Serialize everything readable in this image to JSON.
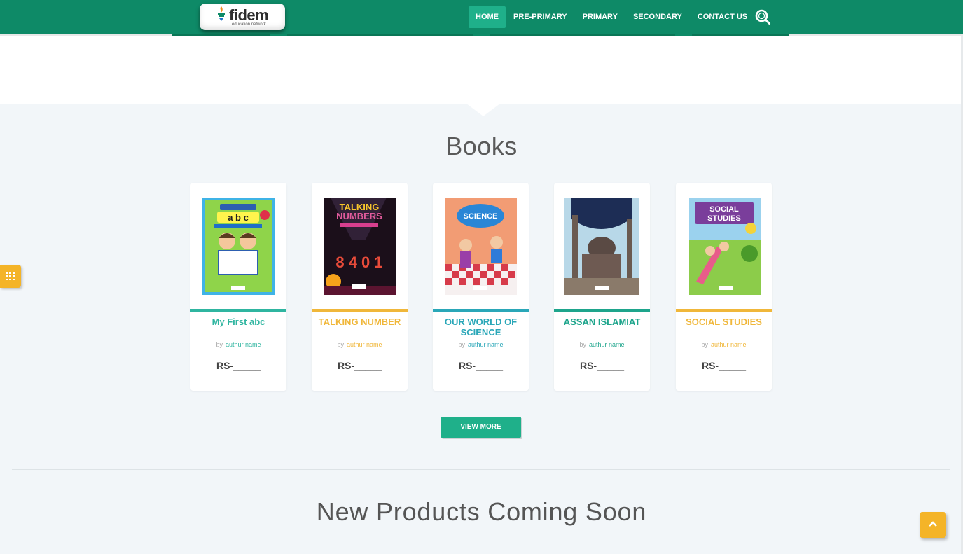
{
  "brand": {
    "name": "fidem",
    "tagline": "education network"
  },
  "nav": {
    "items": [
      {
        "label": "HOME",
        "active": true
      },
      {
        "label": "PRE-PRIMARY",
        "active": false
      },
      {
        "label": "PRIMARY",
        "active": false
      },
      {
        "label": "SECONDARY",
        "active": false
      },
      {
        "label": "CONTACT US",
        "active": false
      }
    ],
    "search_icon": "search-icon"
  },
  "books_section": {
    "title": "Books",
    "books": [
      {
        "title": "My First abc",
        "by": "by",
        "author": "authur name",
        "price": "RS-_____",
        "accent": "#2fb5a0",
        "title_color": "#2fb5a0",
        "author_color": "#2fb5a0"
      },
      {
        "title": "TALKING NUMBER",
        "by": "by",
        "author": "authur name",
        "price": "RS-_____",
        "accent": "#f0b73a",
        "title_color": "#f0b73a",
        "author_color": "#f0b73a"
      },
      {
        "title": "OUR WORLD OF SCIENCE",
        "by": "by",
        "author": "authur name",
        "price": "RS-_____",
        "accent": "#2aa7b8",
        "title_color": "#2aa7b8",
        "author_color": "#2aa7b8"
      },
      {
        "title": "ASSAN ISLAMIAT",
        "by": "by",
        "author": "authur name",
        "price": "RS-_____",
        "accent": "#1ea58c",
        "title_color": "#1ea58c",
        "author_color": "#1ea58c"
      },
      {
        "title": "SOCIAL STUDIES",
        "by": "by",
        "author": "authur name",
        "price": "RS-_____",
        "accent": "#f0b73a",
        "title_color": "#f0b73a",
        "author_color": "#f0b73a"
      }
    ],
    "view_more_label": "VIEW MORE"
  },
  "coming_soon": {
    "title": "New Products Coming Soon"
  },
  "colors": {
    "header": "#0e8a67",
    "active_nav": "#1fb08a",
    "button": "#1fb08a",
    "floating": "#f4b428"
  },
  "floating": {
    "side_tab_icon": "palette-icon",
    "back_to_top_icon": "chevron-up-icon"
  }
}
